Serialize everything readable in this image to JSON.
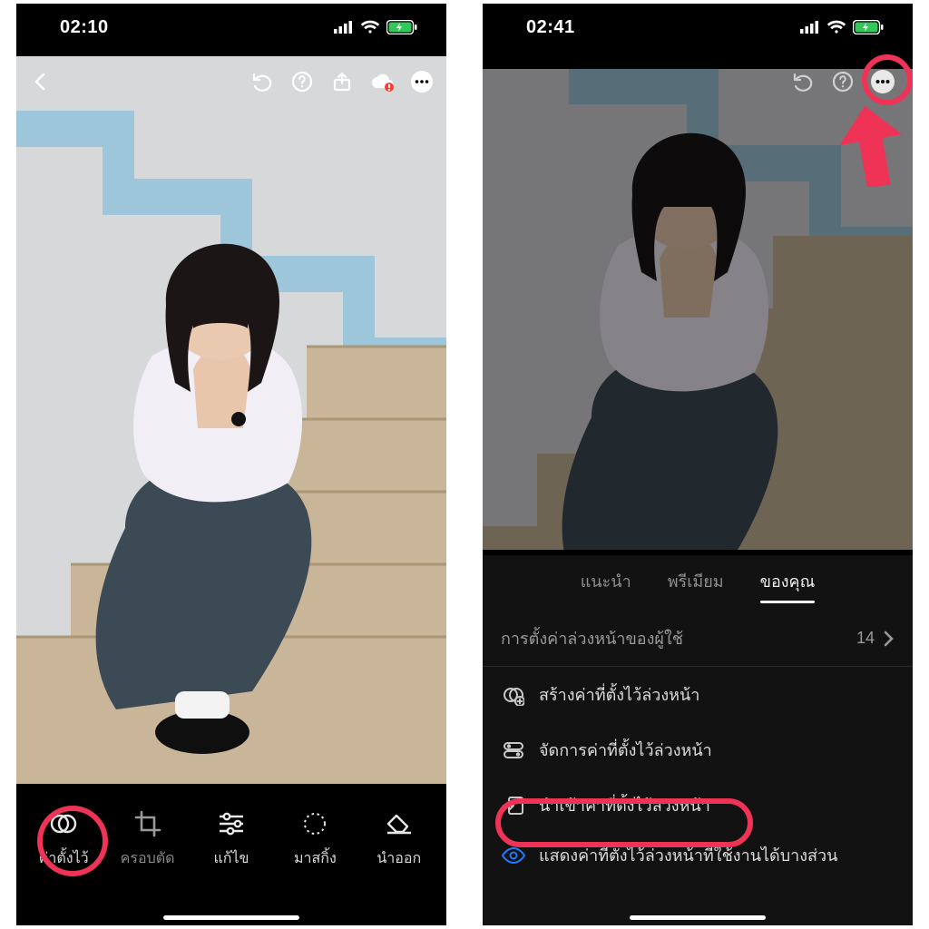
{
  "phoneA": {
    "status": {
      "time": "02:10"
    },
    "tools": [
      {
        "id": "presets",
        "label": "ค่าตั้งไว้"
      },
      {
        "id": "crop",
        "label": "ครอบตัด"
      },
      {
        "id": "edit",
        "label": "แก้ไข"
      },
      {
        "id": "masking",
        "label": "มาสกิ้ง"
      },
      {
        "id": "remove",
        "label": "นำออก"
      }
    ]
  },
  "phoneB": {
    "status": {
      "time": "02:41"
    },
    "tabs": {
      "recommend": "แนะนำ",
      "premium": "พรีเมียม",
      "yours": "ของคุณ"
    },
    "userPresets": {
      "label": "การตั้งค่าล่วงหน้าของผู้ใช้",
      "count": "14"
    },
    "actions": {
      "create": "สร้างค่าที่ตั้งไว้ล่วงหน้า",
      "manage": "จัดการค่าที่ตั้งไว้ล่วงหน้า",
      "import": "นำเข้าค่าที่ตั้งไว้ล่วงหน้า",
      "showPartial": "แสดงค่าที่ตั้งไว้ล่วงหน้าที่ใช้งานได้บางส่วน"
    }
  }
}
